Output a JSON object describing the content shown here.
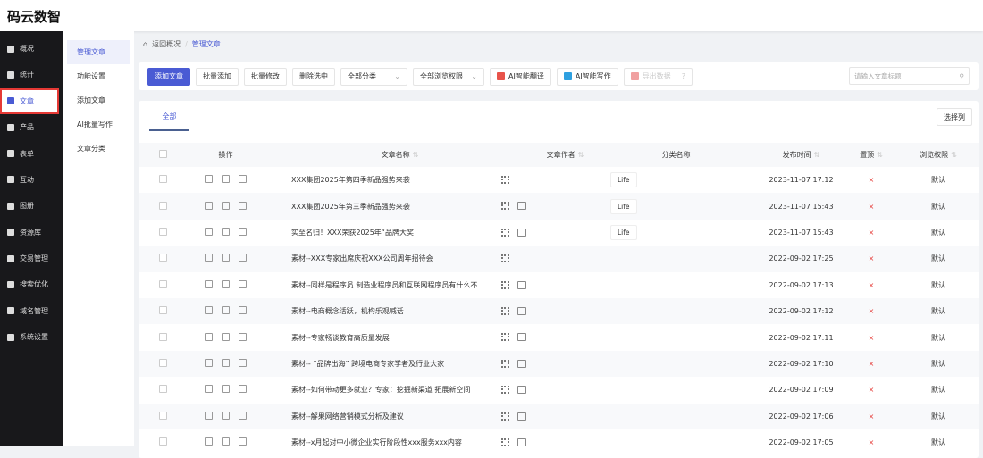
{
  "app_title": "码云数智",
  "sidebar": [
    {
      "label": "概况",
      "icon": "home-icon"
    },
    {
      "label": "统计",
      "icon": "chart-icon"
    },
    {
      "label": "文章",
      "icon": "article-icon",
      "active": true
    },
    {
      "label": "产品",
      "icon": "grid-icon"
    },
    {
      "label": "表单",
      "icon": "form-icon"
    },
    {
      "label": "互动",
      "icon": "chat-icon"
    },
    {
      "label": "图册",
      "icon": "album-icon"
    },
    {
      "label": "资源库",
      "icon": "database-icon"
    },
    {
      "label": "交易管理",
      "icon": "trade-icon"
    },
    {
      "label": "搜索优化",
      "icon": "seo-icon"
    },
    {
      "label": "域名管理",
      "icon": "domain-icon"
    },
    {
      "label": "系统设置",
      "icon": "gear-icon"
    }
  ],
  "submenu": [
    {
      "label": "管理文章",
      "active": true
    },
    {
      "label": "功能设置"
    },
    {
      "label": "添加文章"
    },
    {
      "label": "AI批量写作"
    },
    {
      "label": "文章分类"
    }
  ],
  "breadcrumb": {
    "back": "返回概况",
    "sep": "/",
    "current": "管理文章"
  },
  "toolbar": {
    "add": "添加文章",
    "batch_add": "批量添加",
    "batch_edit": "批量修改",
    "delete": "删除选中",
    "category_select": "全部分类",
    "permission_select": "全部浏览权限",
    "ai_translate": "AI智能翻译",
    "ai_write": "AI智能写作",
    "export": "导出数据",
    "help": "?",
    "search_placeholder": "请输入文章标题"
  },
  "tabs": {
    "all": "全部",
    "choose_columns": "选择列"
  },
  "columns": {
    "ops": "操作",
    "name": "文章名称",
    "author": "文章作者",
    "category": "分类名称",
    "time": "发布时间",
    "top": "置顶",
    "permission": "浏览权限"
  },
  "rows": [
    {
      "name": "XXX集团2025年第四季新品强势来袭",
      "img": false,
      "category": "Life",
      "time": "2023-11-07 17:12",
      "top": "×",
      "permission": "默认"
    },
    {
      "name": "XXX集团2025年第三季新品强势来袭",
      "img": true,
      "category": "Life",
      "time": "2023-11-07 15:43",
      "top": "×",
      "permission": "默认"
    },
    {
      "name": "实至名归！XXX荣获2025年“品牌大奖",
      "img": true,
      "category": "Life",
      "time": "2023-11-07 15:43",
      "top": "×",
      "permission": "默认"
    },
    {
      "name": "素材--XXX专家出席庆祝XXX公司周年招待会",
      "img": false,
      "category": "",
      "time": "2022-09-02 17:25",
      "top": "×",
      "permission": "默认"
    },
    {
      "name": "素材--同样是程序员 制造业程序员和互联网程序员有什么不...",
      "img": true,
      "category": "",
      "time": "2022-09-02 17:13",
      "top": "×",
      "permission": "默认"
    },
    {
      "name": "素材--电商概念活跃，机构乐观喊话",
      "img": true,
      "category": "",
      "time": "2022-09-02 17:12",
      "top": "×",
      "permission": "默认"
    },
    {
      "name": "素材--专家畅谈教育高质量发展",
      "img": true,
      "category": "",
      "time": "2022-09-02 17:11",
      "top": "×",
      "permission": "默认"
    },
    {
      "name": "素材-- “品牌出海” 跨境电商专家学者及行业大家",
      "img": true,
      "category": "",
      "time": "2022-09-02 17:10",
      "top": "×",
      "permission": "默认"
    },
    {
      "name": "素材--如何带动更多就业？专家：挖掘新渠道 拓展新空间",
      "img": true,
      "category": "",
      "time": "2022-09-02 17:09",
      "top": "×",
      "permission": "默认"
    },
    {
      "name": "素材--解果网络营销模式分析及建议",
      "img": true,
      "category": "",
      "time": "2022-09-02 17:06",
      "top": "×",
      "permission": "默认"
    },
    {
      "name": "素材--x月起对中小微企业实行阶段性xxx服务xxx内容",
      "img": true,
      "category": "",
      "time": "2022-09-02 17:05",
      "top": "×",
      "permission": "默认"
    }
  ]
}
